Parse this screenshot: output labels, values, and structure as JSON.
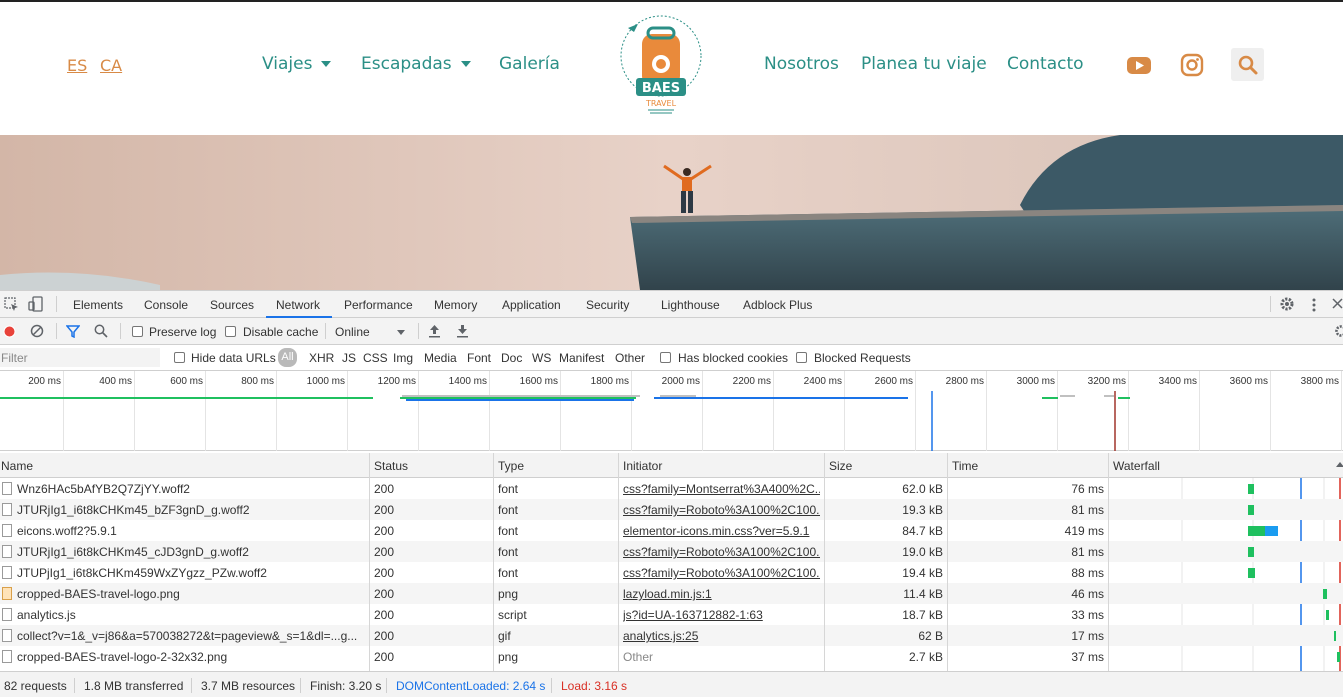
{
  "site": {
    "languages": [
      "ES",
      "CA"
    ],
    "nav_left": [
      {
        "label": "Viajes",
        "has_dropdown": true
      },
      {
        "label": "Escapadas",
        "has_dropdown": true
      },
      {
        "label": "Galería",
        "has_dropdown": false
      }
    ],
    "nav_right": [
      "Nosotros",
      "Planea tu viaje",
      "Contacto"
    ],
    "logo_text": "BAES",
    "logo_subtext": "TRAVEL",
    "colors": {
      "teal": "#2b8f86",
      "orange": "#d88a46"
    }
  },
  "devtools": {
    "tabs": [
      "Elements",
      "Console",
      "Sources",
      "Network",
      "Performance",
      "Memory",
      "Application",
      "Security",
      "Lighthouse",
      "Adblock Plus"
    ],
    "active_tab": "Network",
    "toolbar": {
      "preserve_log": "Preserve log",
      "disable_cache": "Disable cache",
      "throttling": "Online"
    },
    "filterbar": {
      "filter_placeholder": "Filter",
      "hide_data_urls": "Hide data URLs",
      "types": [
        "All",
        "XHR",
        "JS",
        "CSS",
        "Img",
        "Media",
        "Font",
        "Doc",
        "WS",
        "Manifest",
        "Other"
      ],
      "active_type": "All",
      "has_blocked_cookies": "Has blocked cookies",
      "blocked_requests": "Blocked Requests"
    },
    "overview_ticks": [
      "200 ms",
      "400 ms",
      "600 ms",
      "800 ms",
      "1000 ms",
      "1200 ms",
      "1400 ms",
      "1600 ms",
      "1800 ms",
      "2000 ms",
      "2200 ms",
      "2400 ms",
      "2600 ms",
      "2800 ms",
      "3000 ms",
      "3200 ms",
      "3400 ms",
      "3600 ms",
      "3800 ms"
    ],
    "columns": [
      "Name",
      "Status",
      "Type",
      "Initiator",
      "Size",
      "Time",
      "Waterfall"
    ],
    "rows": [
      {
        "name": "Wnz6HAc5bAfYB2Q7ZjYY.woff2",
        "status": "200",
        "type": "font",
        "initiator": "css?family=Montserrat%3A400%2C...",
        "initiator_link": true,
        "size": "62.0 kB",
        "time": "76 ms",
        "icon": "file"
      },
      {
        "name": "JTURjIg1_i6t8kCHKm45_bZF3gnD_g.woff2",
        "status": "200",
        "type": "font",
        "initiator": "css?family=Roboto%3A100%2C100...",
        "initiator_link": true,
        "size": "19.3 kB",
        "time": "81 ms",
        "icon": "file"
      },
      {
        "name": "eicons.woff2?5.9.1",
        "status": "200",
        "type": "font",
        "initiator": "elementor-icons.min.css?ver=5.9.1",
        "initiator_link": true,
        "size": "84.7 kB",
        "time": "419 ms",
        "icon": "file"
      },
      {
        "name": "JTURjIg1_i6t8kCHKm45_cJD3gnD_g.woff2",
        "status": "200",
        "type": "font",
        "initiator": "css?family=Roboto%3A100%2C100...",
        "initiator_link": true,
        "size": "19.0 kB",
        "time": "81 ms",
        "icon": "file"
      },
      {
        "name": "JTUPjIg1_i6t8kCHKm459WxZYgzz_PZw.woff2",
        "status": "200",
        "type": "font",
        "initiator": "css?family=Roboto%3A100%2C100...",
        "initiator_link": true,
        "size": "19.4 kB",
        "time": "88 ms",
        "icon": "file"
      },
      {
        "name": "cropped-BAES-travel-logo.png",
        "status": "200",
        "type": "png",
        "initiator": "lazyload.min.js:1",
        "initiator_link": true,
        "size": "11.4 kB",
        "time": "46 ms",
        "icon": "image"
      },
      {
        "name": "analytics.js",
        "status": "200",
        "type": "script",
        "initiator": "js?id=UA-163712882-1:63",
        "initiator_link": true,
        "size": "18.7 kB",
        "time": "33 ms",
        "icon": "file"
      },
      {
        "name": "collect?v=1&_v=j86&a=570038272&t=pageview&_s=1&dl=...g...",
        "status": "200",
        "type": "gif",
        "initiator": "analytics.js:25",
        "initiator_link": true,
        "size": "62 B",
        "time": "17 ms",
        "icon": "file"
      },
      {
        "name": "cropped-BAES-travel-logo-2-32x32.png",
        "status": "200",
        "type": "png",
        "initiator": "Other",
        "initiator_link": false,
        "size": "2.7 kB",
        "time": "37 ms",
        "icon": "file"
      }
    ],
    "statusbar": {
      "requests": "82 requests",
      "transferred": "1.8 MB transferred",
      "resources": "3.7 MB resources",
      "finish": "Finish: 3.20 s",
      "dom_content_loaded": "DOMContentLoaded: 2.64 s",
      "load": "Load: 3.16 s"
    },
    "colors": {
      "accent": "#1a73e8",
      "dcl": "#1a73e8",
      "load": "#d93025",
      "font_bar": "#1fc05f",
      "download": "#1a9cf0"
    }
  }
}
